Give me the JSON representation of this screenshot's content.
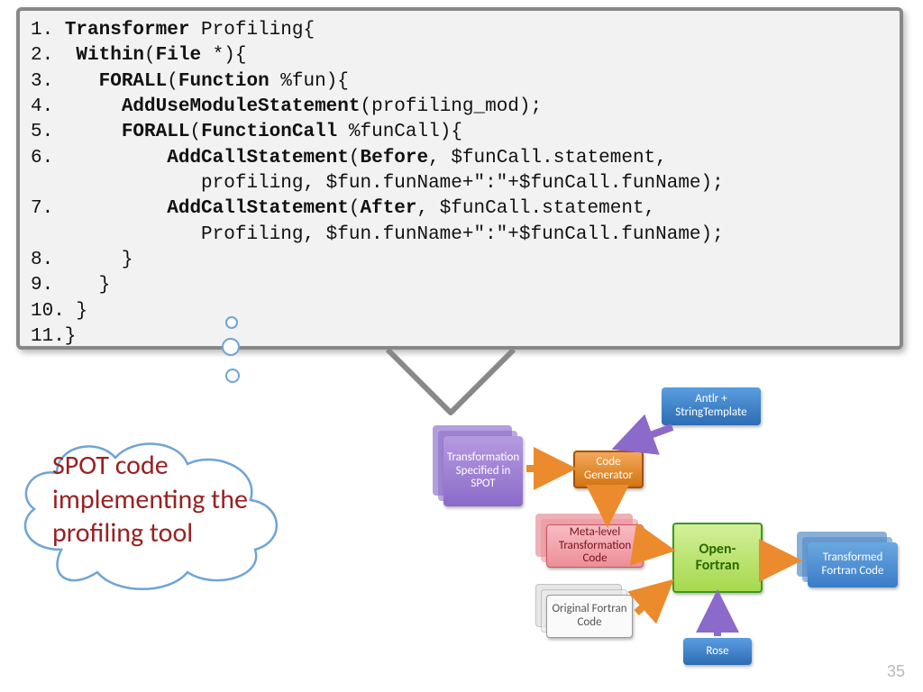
{
  "code": {
    "l1": "1. ",
    "l1b": "Transformer",
    "l1c": " Profiling{",
    "l2": "2.  ",
    "l2b": "Within",
    "l2c": "(",
    "l2d": "File",
    "l2e": " *){",
    "l3": "3.    ",
    "l3b": "FORALL",
    "l3c": "(",
    "l3d": "Function",
    "l3e": " %fun){",
    "l4": "4.      ",
    "l4b": "AddUseModuleStatement",
    "l4c": "(profiling_mod);",
    "l5": "5.      ",
    "l5b": "FORALL",
    "l5c": "(",
    "l5d": "FunctionCall",
    "l5e": " %funCall){",
    "l6": "6.          ",
    "l6b": "AddCallStatement",
    "l6c": "(",
    "l6d": "Before",
    "l6e": ", $funCall.statement,",
    "l6f": "               profiling, $fun.funName+\":\"+$funCall.funName);",
    "l7": "7.          ",
    "l7b": "AddCallStatement",
    "l7c": "(",
    "l7d": "After",
    "l7e": ", $funCall.statement,",
    "l7f": "               Profiling, $fun.funName+\":\"+$funCall.funName);",
    "l8": "8.      }",
    "l9": "9.    }",
    "l10": "10. }",
    "l11": "11.}"
  },
  "cloud_text": "SPOT code implementing the profiling tool",
  "diagram": {
    "spot": "Transformation Specified in SPOT",
    "codegen": "Code Generator",
    "antlr": "Antlr + StringTemplate",
    "meta": "Meta-level Transformation Code",
    "orig": "Original Fortran Code",
    "openfortran": "Open-Fortran",
    "transformed": "Transformed Fortran Code",
    "rose": "Rose"
  },
  "pagenum": "35",
  "colors": {
    "purple": "#9a7ccf",
    "orange": "#e58a2e",
    "blue": "#3a7cc9",
    "pink": "#f29ea5",
    "lime": "#b6e069",
    "limeBorder": "#3c9a1e",
    "teal": "#2d8fce",
    "paper": "#fafafa"
  }
}
